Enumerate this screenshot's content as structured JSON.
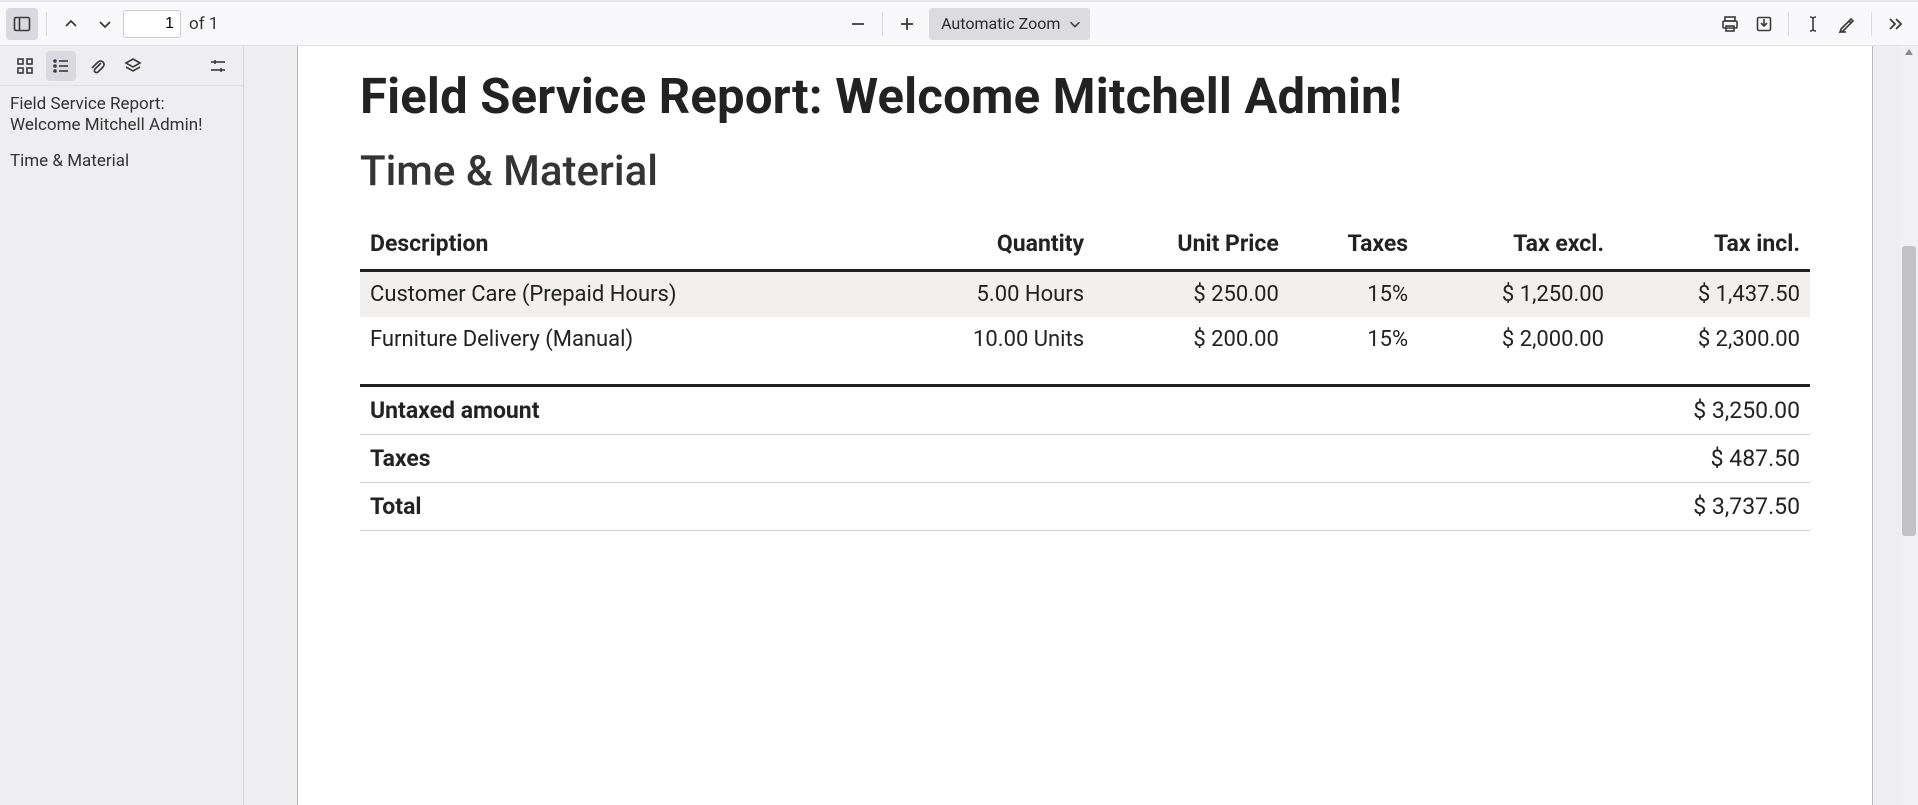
{
  "toolbar": {
    "page_current": "1",
    "page_of": "of 1",
    "zoom_label": "Automatic Zoom"
  },
  "sidebar": {
    "outline": [
      "Field Service Report: Welcome Mitchell Admin!",
      "Time & Material"
    ]
  },
  "document": {
    "title": "Field Service Report: Welcome Mitchell Admin!",
    "section": "Time & Material",
    "columns": [
      "Description",
      "Quantity",
      "Unit Price",
      "Taxes",
      "Tax excl.",
      "Tax incl."
    ],
    "rows": [
      {
        "desc": "Customer Care (Prepaid Hours)",
        "qty": "5.00 Hours",
        "unit": "$ 250.00",
        "taxes": "15%",
        "excl": "$ 1,250.00",
        "incl": "$ 1,437.50"
      },
      {
        "desc": "Furniture Delivery (Manual)",
        "qty": "10.00 Units",
        "unit": "$ 200.00",
        "taxes": "15%",
        "excl": "$ 2,000.00",
        "incl": "$ 2,300.00"
      }
    ],
    "totals": [
      {
        "label": "Untaxed amount",
        "value": "$ 3,250.00"
      },
      {
        "label": "Taxes",
        "value": "$ 487.50"
      },
      {
        "label": "Total",
        "value": "$ 3,737.50"
      }
    ]
  }
}
